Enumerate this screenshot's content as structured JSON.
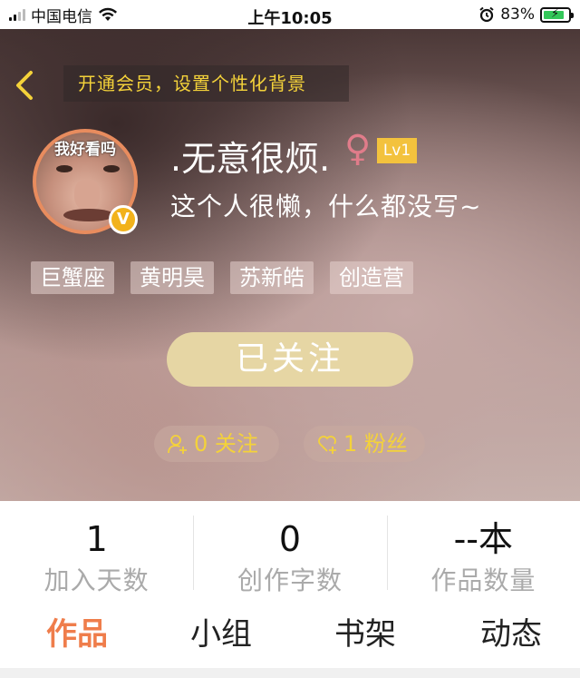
{
  "status_bar": {
    "carrier": "中国电信",
    "time": "上午10:05",
    "battery_percent": "83%",
    "battery_level": 0.83,
    "icons": [
      "signal-icon",
      "wifi-icon",
      "alarm-icon",
      "battery-charging-icon"
    ]
  },
  "header": {
    "vip_banner": "开通会员，设置个性化背景",
    "avatar_caption": "我好看吗",
    "username": ".无意很烦.",
    "gender_symbol": "♀",
    "level": "Lv1",
    "verified_badge": "V",
    "bio": "这个人很懒，什么都没写~",
    "tags": [
      "巨蟹座",
      "黄明昊",
      "苏新皓",
      "创造营"
    ],
    "follow_button": "已关注",
    "following": "0 关注",
    "fans": "1 粉丝"
  },
  "stats": [
    {
      "value": "1",
      "label": "加入天数"
    },
    {
      "value": "0",
      "label": "创作字数"
    },
    {
      "value": "--本",
      "label": "作品数量"
    }
  ],
  "tabs": [
    {
      "label": "作品",
      "active": true
    },
    {
      "label": "小组",
      "active": false
    },
    {
      "label": "书架",
      "active": false
    },
    {
      "label": "动态",
      "active": false
    }
  ],
  "colors": {
    "accent_yellow": "#f4d23a",
    "active_tab": "#ef7d4b",
    "follow_button": "#e6d6a4",
    "level_badge": "#f3c23d"
  }
}
